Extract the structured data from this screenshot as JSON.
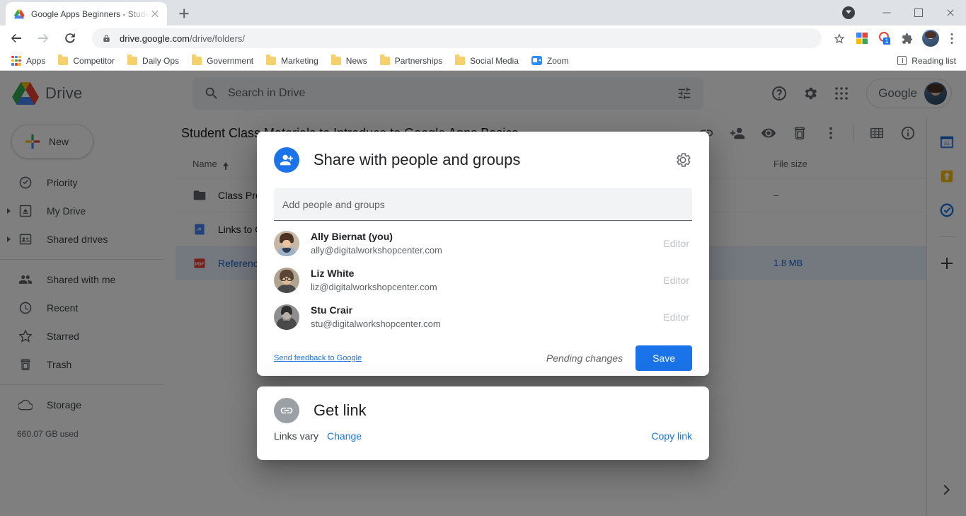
{
  "browser": {
    "tab": {
      "title": "Google Apps Beginners - Studen",
      "favicon": "drive-icon"
    },
    "newtab_label": "+",
    "url": "drive.google.com",
    "url_path": "/drive/folders/",
    "reading_list": "Reading list",
    "bookmarks": [
      {
        "label": "Apps",
        "icon": "apps-grid-icon"
      },
      {
        "label": "Competitor",
        "icon": "folder-icon"
      },
      {
        "label": "Daily Ops",
        "icon": "folder-icon"
      },
      {
        "label": "Government",
        "icon": "folder-icon"
      },
      {
        "label": "Marketing",
        "icon": "folder-icon"
      },
      {
        "label": "News",
        "icon": "folder-icon"
      },
      {
        "label": "Partnerships",
        "icon": "folder-icon"
      },
      {
        "label": "Social Media",
        "icon": "folder-icon"
      },
      {
        "label": "Zoom",
        "icon": "zoom-icon"
      }
    ]
  },
  "drive": {
    "product_name": "Drive",
    "search_placeholder": "Search in Drive",
    "google_chip": "Google",
    "new_button": "New",
    "sidebar": [
      {
        "label": "Priority",
        "icon": "priority-check-icon",
        "expandable": false
      },
      {
        "label": "My Drive",
        "icon": "my-drive-icon",
        "expandable": true
      },
      {
        "label": "Shared drives",
        "icon": "shared-drives-icon",
        "expandable": true
      },
      {
        "label": "Shared with me",
        "icon": "people-icon",
        "expandable": false
      },
      {
        "label": "Recent",
        "icon": "clock-icon",
        "expandable": false
      },
      {
        "label": "Starred",
        "icon": "star-icon",
        "expandable": false
      },
      {
        "label": "Trash",
        "icon": "trash-icon",
        "expandable": false
      },
      {
        "label": "Storage",
        "icon": "cloud-icon",
        "expandable": false
      }
    ],
    "storage_used": "660.07 GB used",
    "breadcrumb": "Student Class Materials to Introduce to Google Apps Basics",
    "columns": {
      "name": "Name",
      "file_size": "File size"
    },
    "files": [
      {
        "name": "Class Presentation",
        "size": "–",
        "icon": "folder-icon",
        "selected": false
      },
      {
        "name": "Links to Class Resources",
        "size": "",
        "icon": "shortcut-icon",
        "selected": false
      },
      {
        "name": "Reference Guide",
        "size": "1.8 MB",
        "icon": "pdf-icon",
        "selected": true
      }
    ]
  },
  "share_dialog": {
    "title": "Share with people and groups",
    "badge_icon": "person-add-icon",
    "settings_icon": "gear-icon",
    "add_placeholder": "Add people and groups",
    "people": [
      {
        "name": "Ally Biernat (you)",
        "email": "ally@digitalworkshopcenter.com",
        "role": "Editor"
      },
      {
        "name": "Liz White",
        "email": "liz@digitalworkshopcenter.com",
        "role": "Editor"
      },
      {
        "name": "Stu Crair",
        "email": "stu@digitalworkshopcenter.com",
        "role": "Editor"
      }
    ],
    "feedback_link": "Send feedback to Google",
    "pending_label": "Pending changes",
    "save_label": "Save"
  },
  "get_link": {
    "title": "Get link",
    "badge_icon": "link-icon",
    "status": "Links vary",
    "change_label": "Change",
    "copy_label": "Copy link"
  },
  "colors": {
    "accent_blue": "#1a73e8",
    "selected_row": "#e8f0fe",
    "scrim": "rgba(0,0,0,0.5)"
  }
}
